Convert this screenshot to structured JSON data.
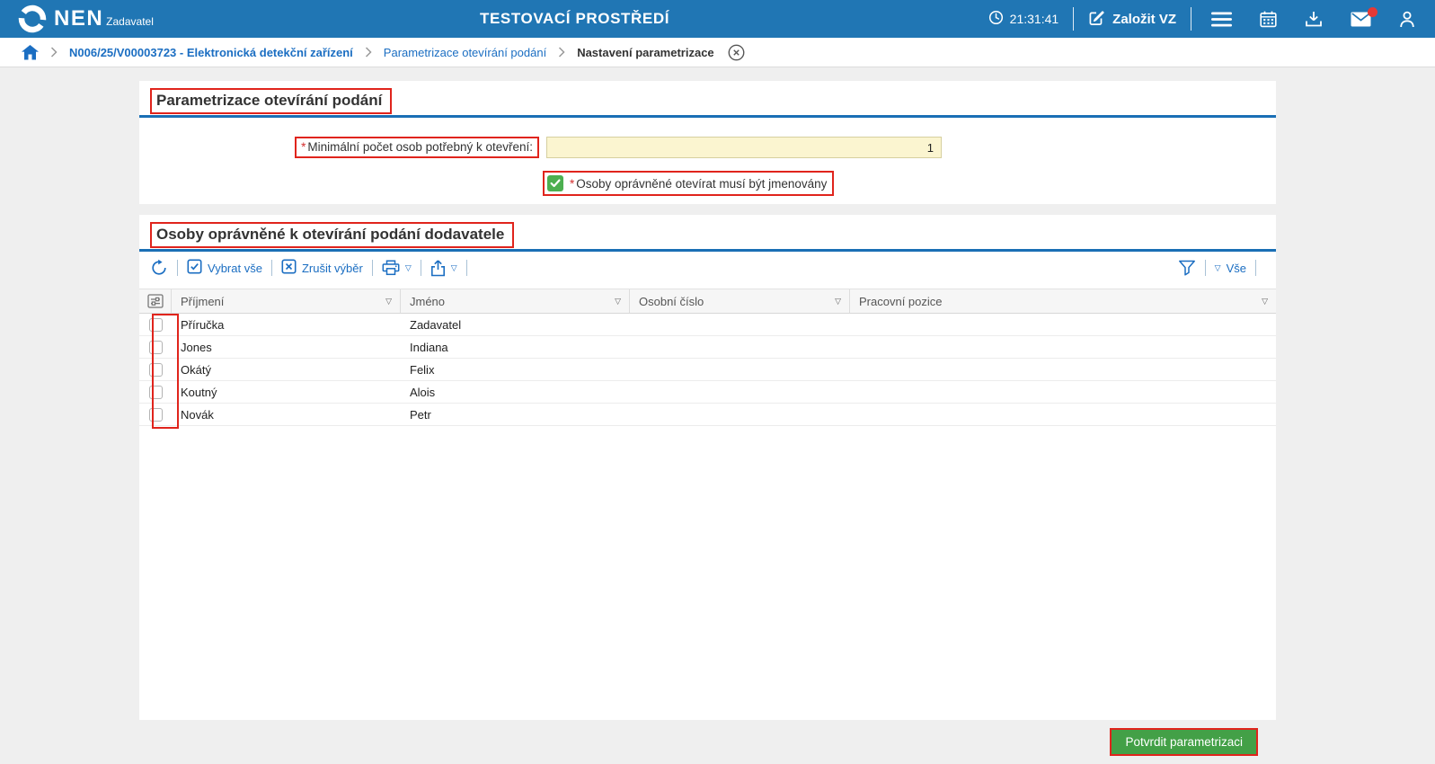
{
  "header": {
    "logo": "NEN",
    "role": "Zadavatel",
    "env_title": "TESTOVACÍ PROSTŘEDÍ",
    "time": "21:31:41",
    "create_label": "Založit VZ"
  },
  "breadcrumb": {
    "item1": "N006/25/V00003723 - Elektronická detekční zařízení",
    "item2": "Parametrizace otevírání podání",
    "item3": "Nastavení parametrizace"
  },
  "parametrization": {
    "title": "Parametrizace otevírání podání",
    "min_required_mark": "*",
    "min_label": "Minimální počet osob potřebný k otevření:",
    "min_value": "1",
    "named_required_mark": "*",
    "named_label": "Osoby oprávněné otevírat musí být jmenovány",
    "named_checked": true
  },
  "persons": {
    "title": "Osoby oprávněné k otevírání podání dodavatele",
    "toolbar": {
      "select_all": "Vybrat vše",
      "clear_selection": "Zrušit výběr",
      "all_filter": "Vše"
    },
    "columns": [
      "Příjmení",
      "Jméno",
      "Osobní číslo",
      "Pracovní pozice"
    ],
    "rows": [
      {
        "surname": "Příručka",
        "name": "Zadavatel",
        "personal_number": "",
        "position": ""
      },
      {
        "surname": "Jones",
        "name": "Indiana",
        "personal_number": "",
        "position": ""
      },
      {
        "surname": "Okátý",
        "name": "Felix",
        "personal_number": "",
        "position": ""
      },
      {
        "surname": "Koutný",
        "name": "Alois",
        "personal_number": "",
        "position": ""
      },
      {
        "surname": "Novák",
        "name": "Petr",
        "personal_number": "",
        "position": ""
      }
    ]
  },
  "footer": {
    "confirm": "Potvrdit parametrizaci"
  },
  "icons": {
    "triangle_down": "▽"
  },
  "colors": {
    "header_bg": "#2076b4",
    "accent_rule_blue": "#1a6fb5",
    "link_blue": "#1b6ec2",
    "annotation_red": "#e0241c",
    "input_yellow": "#fbf5d0",
    "checkbox_green": "#4caf50",
    "confirm_green": "#43a047",
    "badge_red": "#e53935"
  }
}
